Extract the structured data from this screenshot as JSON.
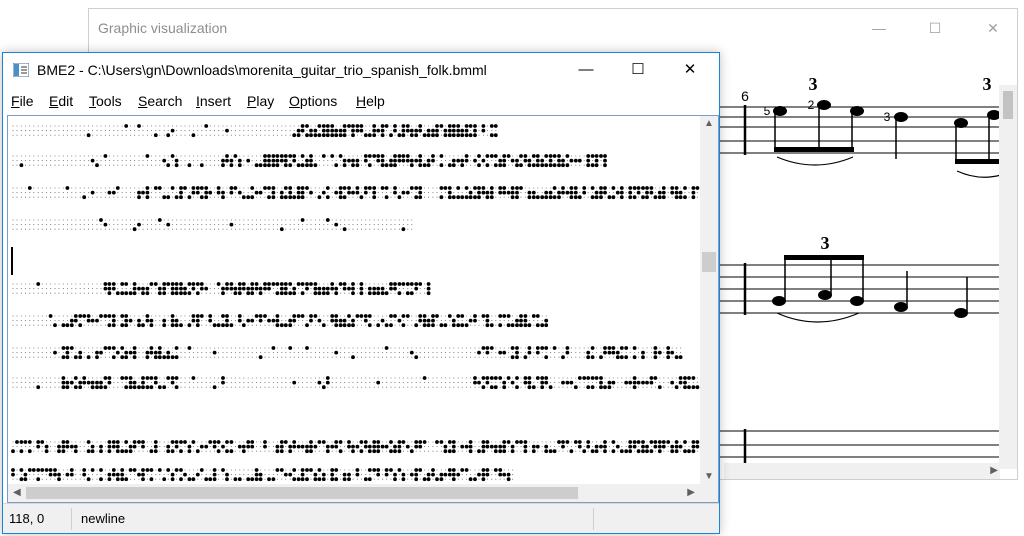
{
  "graphic_window": {
    "title": "Graphic visualization",
    "controls": {
      "minimize": "—",
      "maximize": "☐",
      "close": "✕"
    },
    "score": {
      "measure_number": "6",
      "fingerings": [
        "5",
        "2",
        "3"
      ],
      "tuplet_marks": [
        "3",
        "3",
        "3"
      ]
    }
  },
  "main_window": {
    "title": "BME2 - C:\\Users\\gn\\Downloads\\morenita_guitar_trio_spanish_folk.bmml",
    "icon": "app-icon",
    "controls": {
      "minimize": "—",
      "maximize": "☐",
      "close": "✕"
    },
    "menu": [
      {
        "mnemonic": "F",
        "rest": "ile"
      },
      {
        "mnemonic": "E",
        "rest": "dit"
      },
      {
        "mnemonic": "T",
        "rest": "ools"
      },
      {
        "mnemonic": "S",
        "rest": "earch"
      },
      {
        "mnemonic": "I",
        "rest": "nsert"
      },
      {
        "mnemonic": "P",
        "rest": "lay"
      },
      {
        "mnemonic": "O",
        "rest": "ptions"
      },
      {
        "mnemonic": "H",
        "rest": "elp"
      }
    ],
    "status": {
      "position": "118, 0",
      "message": "newline"
    }
  },
  "colors": {
    "accent": "#1883d7",
    "scrollbar": "#f0f0f0",
    "thumb": "#cdcdcd"
  }
}
